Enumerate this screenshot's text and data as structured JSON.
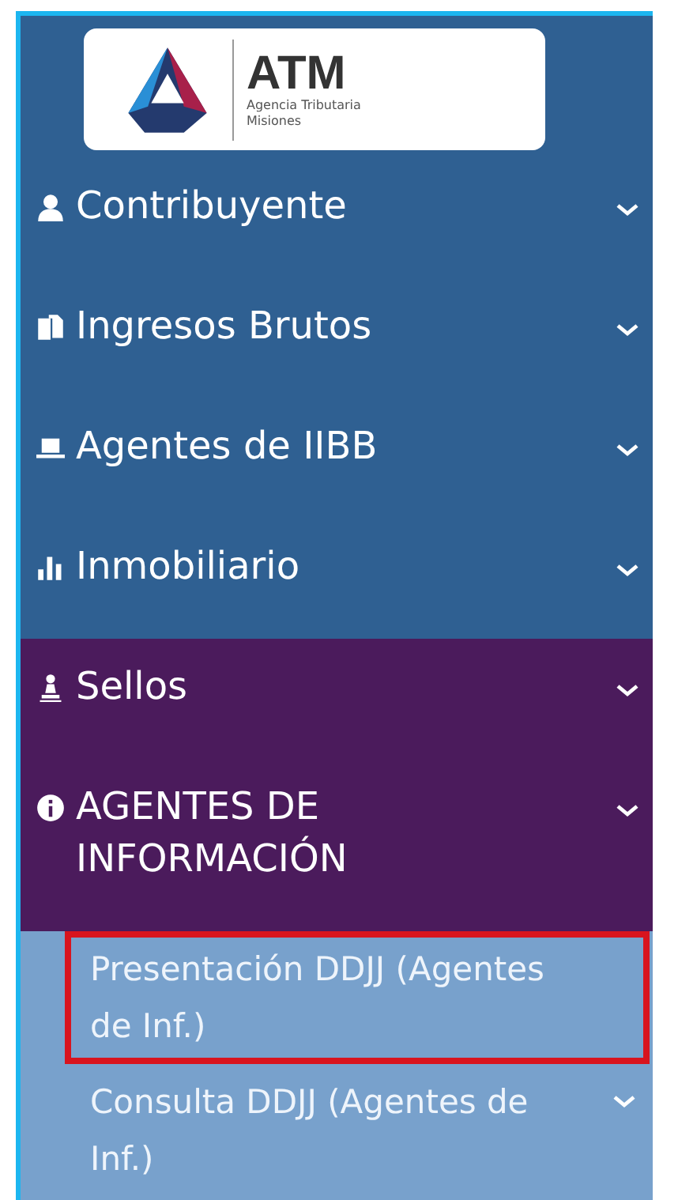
{
  "logo": {
    "title": "ATM",
    "subtitle": "Agencia Tributaria\nMisiones"
  },
  "menu": [
    {
      "label": "Contribuyente",
      "active": false
    },
    {
      "label": "Ingresos Brutos",
      "active": false
    },
    {
      "label": "Agentes de IIBB",
      "active": false
    },
    {
      "label": "Inmobiliario",
      "active": false
    },
    {
      "label": "Sellos",
      "active": true
    },
    {
      "label": "AGENTES DE INFORMACIÓN",
      "active": true
    }
  ],
  "submenu": [
    {
      "label": "Presentación DDJJ (Agentes de Inf.)",
      "highlighted": true,
      "has_submenu": false
    },
    {
      "label": "Consulta DDJJ (Agentes de Inf.)",
      "highlighted": false,
      "has_submenu": true
    }
  ]
}
